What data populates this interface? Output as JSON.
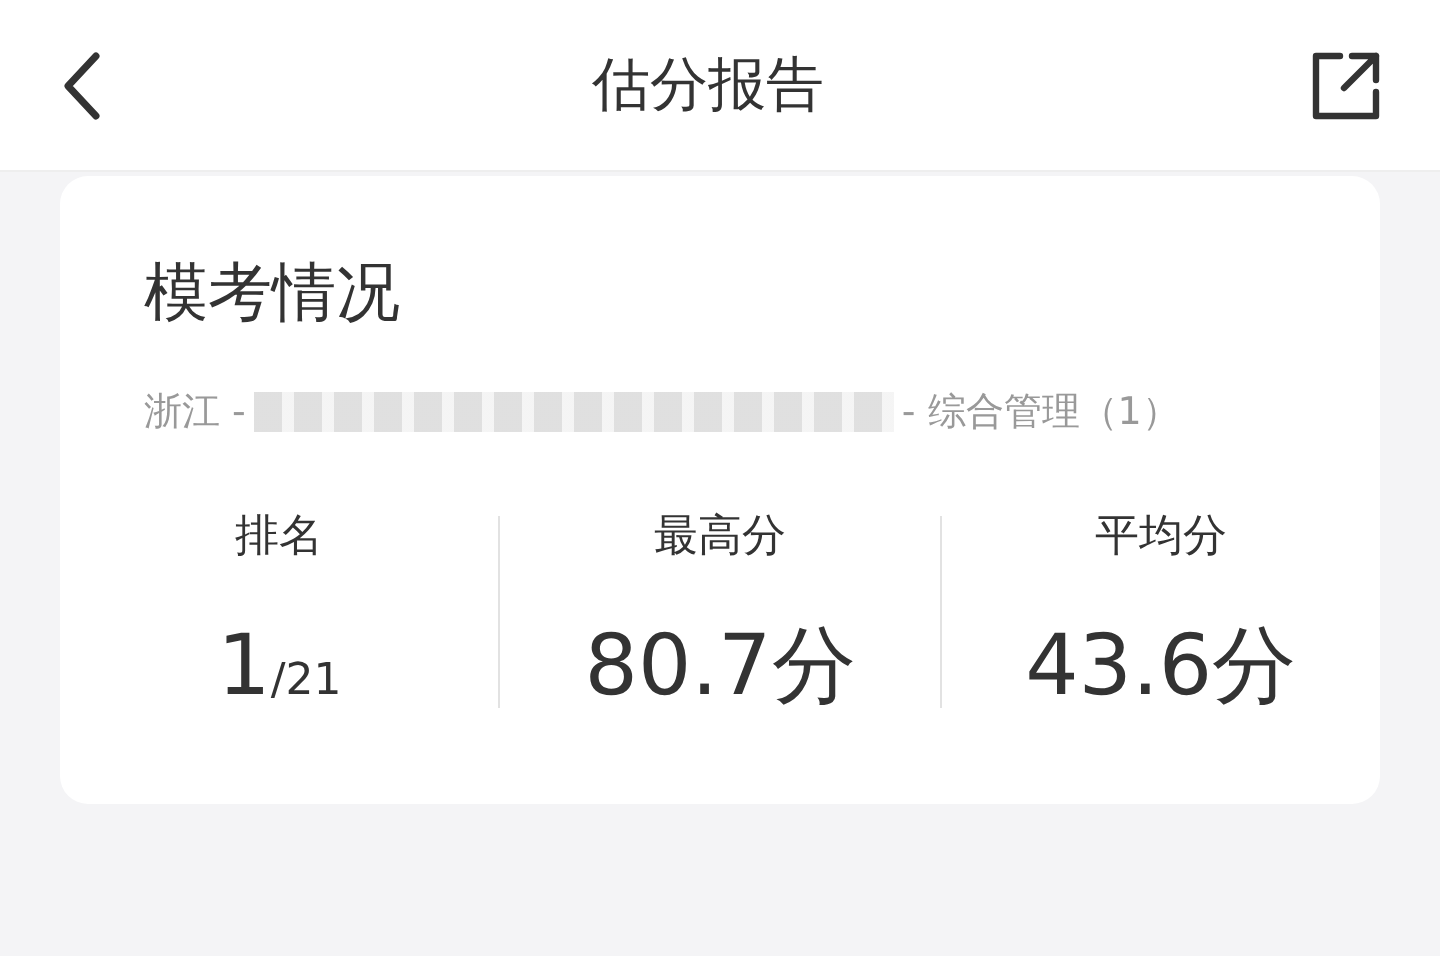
{
  "header": {
    "title": "估分报告"
  },
  "card": {
    "title": "模考情况",
    "subtitle_start": "浙江 -",
    "redacted": true,
    "subtitle_end": "- 综合管理（1）",
    "stats": [
      {
        "label": "排名",
        "value": "1",
        "suffix": "/21"
      },
      {
        "label": "最高分",
        "value": "80.7分"
      },
      {
        "label": "平均分",
        "value": "43.6分"
      }
    ]
  }
}
